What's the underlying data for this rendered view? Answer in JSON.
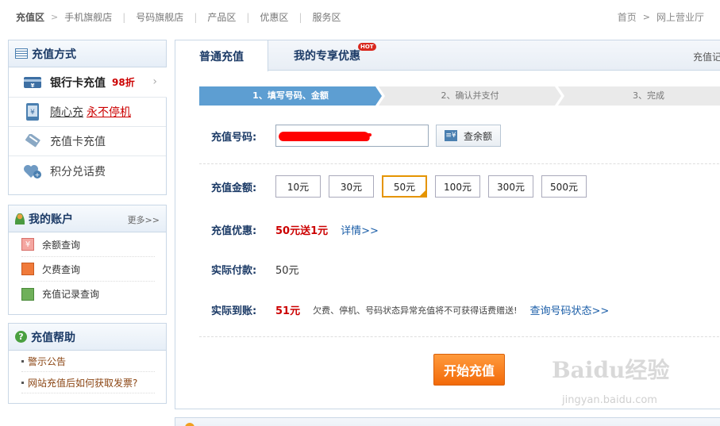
{
  "topnav": {
    "home": "充值区",
    "links": [
      "手机旗舰店",
      "号码旗舰店",
      "产品区",
      "优惠区",
      "服务区"
    ],
    "right": [
      "首页",
      "网上营业厅"
    ]
  },
  "method_box": {
    "title": "充值方式",
    "items": [
      {
        "label": "银行卡充值",
        "badge": "98折"
      },
      {
        "label": "随心充",
        "extra": "永不停机"
      },
      {
        "label": "充值卡充值"
      },
      {
        "label": "积分兑话费"
      }
    ]
  },
  "account_box": {
    "title": "我的账户",
    "more": "更多>>",
    "items": [
      "余额查询",
      "欠费查询",
      "充值记录查询"
    ]
  },
  "help_box": {
    "title": "充值帮助",
    "items": [
      "警示公告",
      "网站充值后如何获取发票?"
    ]
  },
  "tabs": {
    "normal": "普通充值",
    "exclusive": "我的专享优惠",
    "hot": "HOT",
    "record": "充值记"
  },
  "steps": [
    "1、填写号码、金额",
    "2、确认并支付",
    "3、完成"
  ],
  "form": {
    "phone_label": "充值号码:",
    "balance_btn": "查余额",
    "amount_label": "充值金额:",
    "amounts": [
      "10元",
      "30元",
      "50元",
      "100元",
      "300元",
      "500元"
    ],
    "selected_amount": "50元",
    "promo_label": "充值优惠:",
    "promo_value": "50元送1元",
    "promo_link": "详情>>",
    "pay_label": "实际付款:",
    "pay_value": "50元",
    "arrive_label": "实际到账:",
    "arrive_value": "51元",
    "arrive_note": "欠费、停机、号码状态异常充值将不可获得话费赠送!",
    "status_link": "查询号码状态>>",
    "submit": "开始充值"
  },
  "watermark": {
    "main": "Baidu经验",
    "sub": "jingyan.baidu.com"
  }
}
